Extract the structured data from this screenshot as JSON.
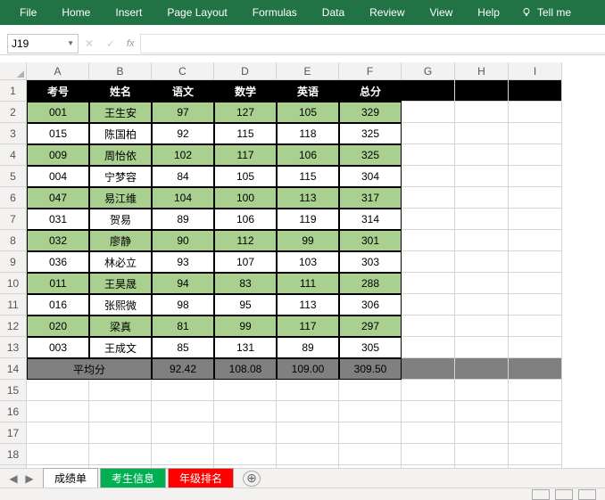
{
  "ribbon": {
    "tabs": [
      "File",
      "Home",
      "Insert",
      "Page Layout",
      "Formulas",
      "Data",
      "Review",
      "View",
      "Help"
    ],
    "tellme": "Tell me"
  },
  "namebox": "J19",
  "fx_label": "fx",
  "fx_buttons": {
    "cancel": "✕",
    "confirm": "✓",
    "fx": "fx"
  },
  "columns": [
    "A",
    "B",
    "C",
    "D",
    "E",
    "F",
    "G",
    "H",
    "I"
  ],
  "row_count": 19,
  "table": {
    "headers": [
      "考号",
      "姓名",
      "语文",
      "数学",
      "英语",
      "总分"
    ],
    "rows": [
      [
        "001",
        "王生安",
        "97",
        "127",
        "105",
        "329"
      ],
      [
        "015",
        "陈国柏",
        "92",
        "115",
        "118",
        "325"
      ],
      [
        "009",
        "周怡依",
        "102",
        "117",
        "106",
        "325"
      ],
      [
        "004",
        "宁梦容",
        "84",
        "105",
        "115",
        "304"
      ],
      [
        "047",
        "易江维",
        "104",
        "100",
        "113",
        "317"
      ],
      [
        "031",
        "贺易",
        "89",
        "106",
        "119",
        "314"
      ],
      [
        "032",
        "廖静",
        "90",
        "112",
        "99",
        "301"
      ],
      [
        "036",
        "林必立",
        "93",
        "107",
        "103",
        "303"
      ],
      [
        "011",
        "王昊晟",
        "94",
        "83",
        "111",
        "288"
      ],
      [
        "016",
        "张熙微",
        "98",
        "95",
        "113",
        "306"
      ],
      [
        "020",
        "梁真",
        "81",
        "99",
        "117",
        "297"
      ],
      [
        "003",
        "王成文",
        "85",
        "131",
        "89",
        "305"
      ]
    ],
    "avg_label": "平均分",
    "avg": [
      "92.42",
      "108.08",
      "109.00",
      "309.50"
    ]
  },
  "sheets": {
    "tabs": [
      {
        "label": "成绩单",
        "color": "white"
      },
      {
        "label": "考生信息",
        "color": "green"
      },
      {
        "label": "年级排名",
        "color": "red"
      }
    ]
  },
  "cursor_cell": "J19",
  "chart_data": {
    "type": "table",
    "title": "",
    "columns": [
      "考号",
      "姓名",
      "语文",
      "数学",
      "英语",
      "总分"
    ],
    "data": [
      {
        "考号": "001",
        "姓名": "王生安",
        "语文": 97,
        "数学": 127,
        "英语": 105,
        "总分": 329
      },
      {
        "考号": "015",
        "姓名": "陈国柏",
        "语文": 92,
        "数学": 115,
        "英语": 118,
        "总分": 325
      },
      {
        "考号": "009",
        "姓名": "周怡依",
        "语文": 102,
        "数学": 117,
        "英语": 106,
        "总分": 325
      },
      {
        "考号": "004",
        "姓名": "宁梦容",
        "语文": 84,
        "数学": 105,
        "英语": 115,
        "总分": 304
      },
      {
        "考号": "047",
        "姓名": "易江维",
        "语文": 104,
        "数学": 100,
        "英语": 113,
        "总分": 317
      },
      {
        "考号": "031",
        "姓名": "贺易",
        "语文": 89,
        "数学": 106,
        "英语": 119,
        "总分": 314
      },
      {
        "考号": "032",
        "姓名": "廖静",
        "语文": 90,
        "数学": 112,
        "英语": 99,
        "总分": 301
      },
      {
        "考号": "036",
        "姓名": "林必立",
        "语文": 93,
        "数学": 107,
        "英语": 103,
        "总分": 303
      },
      {
        "考号": "011",
        "姓名": "王昊晟",
        "语文": 94,
        "数学": 83,
        "英语": 111,
        "总分": 288
      },
      {
        "考号": "016",
        "姓名": "张熙微",
        "语文": 98,
        "数学": 95,
        "英语": 113,
        "总分": 306
      },
      {
        "考号": "020",
        "姓名": "梁真",
        "语文": 81,
        "数学": 99,
        "英语": 117,
        "总分": 297
      },
      {
        "考号": "003",
        "姓名": "王成文",
        "语文": 85,
        "数学": 131,
        "英语": 89,
        "总分": 305
      }
    ],
    "summary": {
      "平均分": {
        "语文": 92.42,
        "数学": 108.08,
        "英语": 109.0,
        "总分": 309.5
      }
    }
  }
}
